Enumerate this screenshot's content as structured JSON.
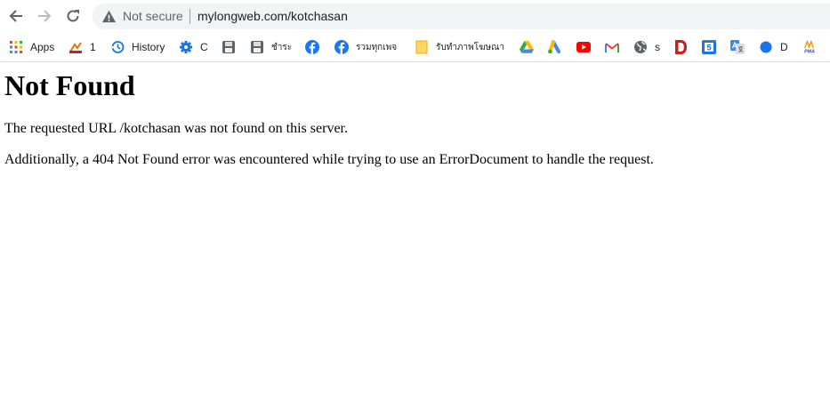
{
  "browser": {
    "security_label": "Not secure",
    "url": "mylongweb.com/kotchasan"
  },
  "bookmarks": [
    {
      "label": "Apps",
      "icon": "apps-grid-icon"
    },
    {
      "label": "1",
      "icon": "chart-icon"
    },
    {
      "label": "History",
      "icon": "history-icon"
    },
    {
      "label": "C",
      "icon": "gear-icon"
    },
    {
      "label": "",
      "icon": "save-disk-icon"
    },
    {
      "label": "ชำระ",
      "icon": "save-disk-icon"
    },
    {
      "label": "",
      "icon": "facebook-icon"
    },
    {
      "label": "รวมทุกเพจ",
      "icon": "facebook-icon"
    },
    {
      "label": "รับทำภาพโฆษณา",
      "icon": "sticky-note-icon"
    },
    {
      "label": "",
      "icon": "google-drive-icon"
    },
    {
      "label": "",
      "icon": "google-ads-icon"
    },
    {
      "label": "",
      "icon": "youtube-icon"
    },
    {
      "label": "",
      "icon": "gmail-icon"
    },
    {
      "label": "s",
      "icon": "globe-icon"
    },
    {
      "label": "",
      "icon": "d-logo-icon"
    },
    {
      "label": "",
      "icon": "calendar-icon"
    },
    {
      "label": "",
      "icon": "translate-icon"
    },
    {
      "label": "D",
      "icon": "blue-dot-icon"
    },
    {
      "label": "",
      "icon": "pma-logo-icon"
    }
  ],
  "page": {
    "heading": "Not Found",
    "paragraph1": "The requested URL /kotchasan was not found on this server.",
    "paragraph2": "Additionally, a 404 Not Found error was encountered while trying to use an ErrorDocument to handle the request."
  },
  "colors": {
    "omnibox_bg": "#f1f3f4",
    "nav_icon": "#5f6368",
    "facebook_blue": "#1877f2",
    "youtube_red": "#ff0000"
  }
}
